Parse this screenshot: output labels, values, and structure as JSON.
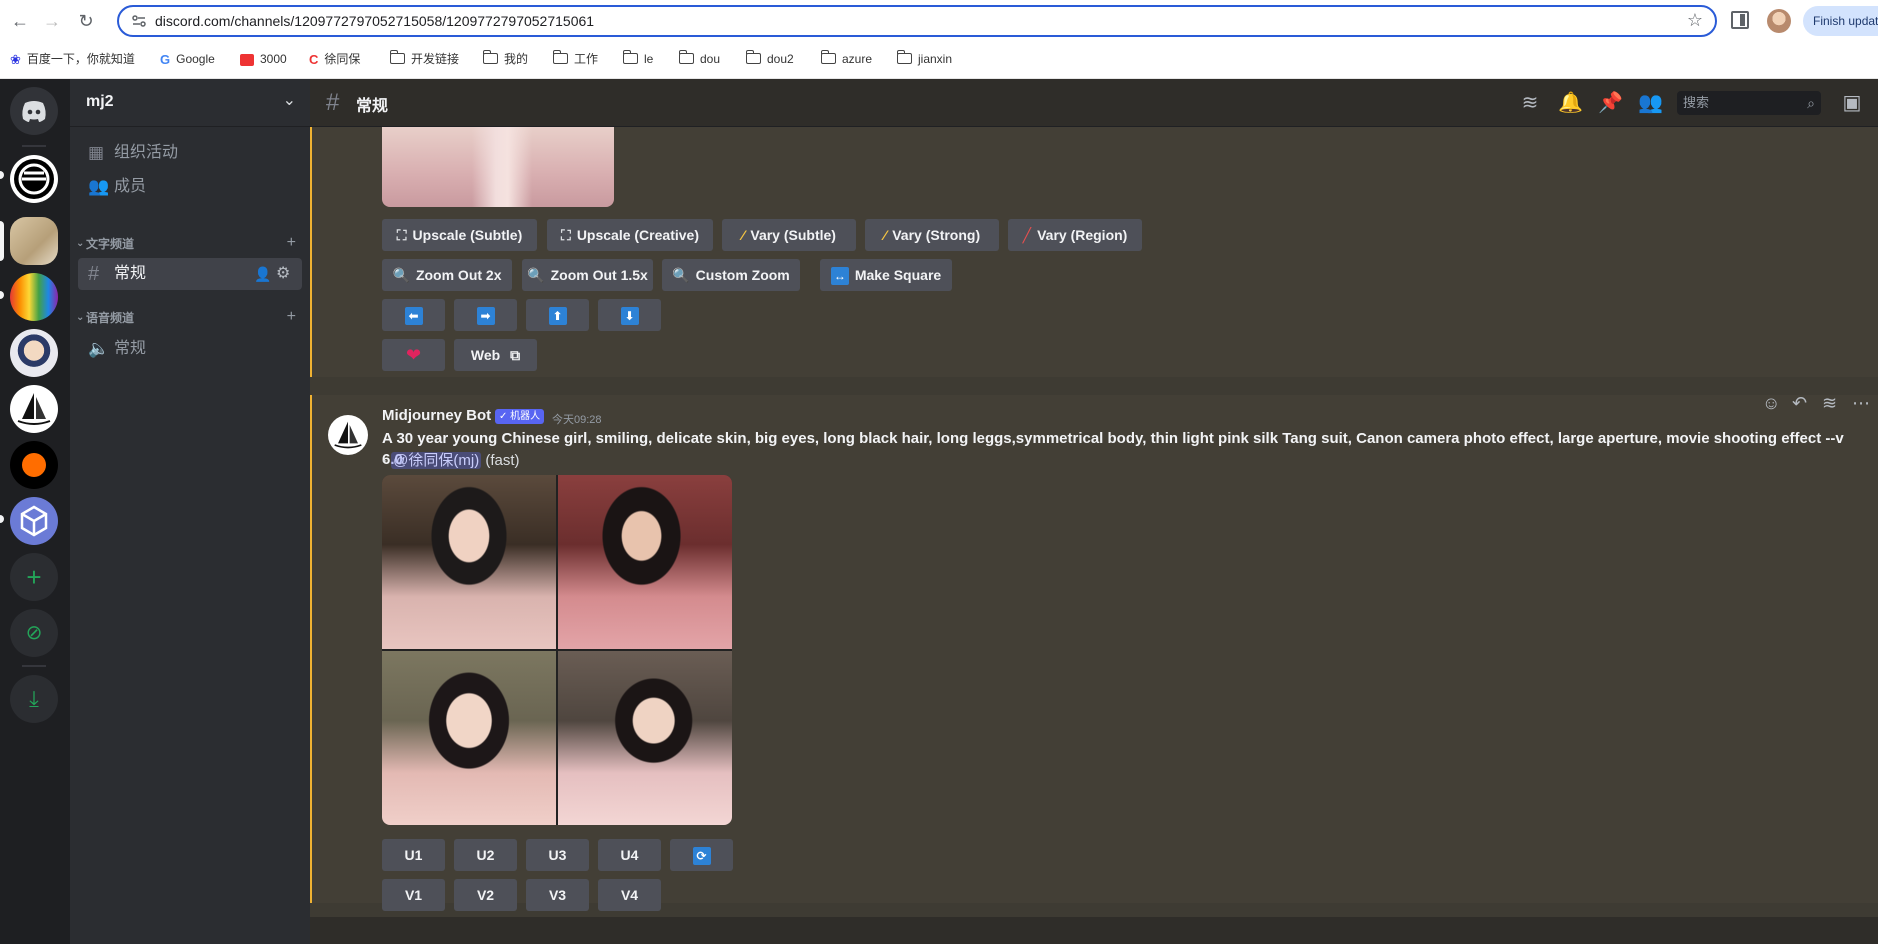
{
  "browser": {
    "url": "discord.com/channels/1209772797052715058/1209772797052715061",
    "finish_update": "Finish update",
    "bookmarks": [
      "百度一下，你就知道",
      "Google",
      "3000",
      "徐同保",
      "开发链接",
      "我的",
      "工作",
      "le",
      "dou",
      "dou2",
      "azure",
      "jianxin"
    ]
  },
  "guild": {
    "name": "mj2",
    "events": "组织活动",
    "members": "成员",
    "text_category": "文字频道",
    "text_channel": "常规",
    "voice_category": "语音频道",
    "voice_channel": "常规"
  },
  "header": {
    "channel": "常规",
    "search_placeholder": "搜索"
  },
  "prev_message": {
    "buttons_row1": [
      "Upscale (Subtle)",
      "Upscale (Creative)",
      "Vary (Subtle)",
      "Vary (Strong)",
      "Vary (Region)"
    ],
    "buttons_row2": [
      "Zoom Out 2x",
      "Zoom Out 1.5x",
      "Custom Zoom",
      "Make Square"
    ],
    "web": "Web"
  },
  "message": {
    "author": "Midjourney Bot",
    "bot_tag": "✓ 机器人",
    "timestamp": "今天09:28",
    "prompt": "A 30 year young Chinese girl, smiling, delicate skin, big eyes, long black hair, long leggs,symmetrical body, thin light pink silk Tang suit, Canon camera photo effect, large aperture, movie shooting effect --v 6.0",
    "prefix": "- ",
    "mention": "@徐同保(mj)",
    "mode": " (fast)",
    "u_buttons": [
      "U1",
      "U2",
      "U3",
      "U4"
    ],
    "v_buttons": [
      "V1",
      "V2",
      "V3",
      "V4"
    ]
  },
  "colors": {
    "accent_border": "#f0b232",
    "button_bg": "#4e5058",
    "bot_tag": "#5865f2"
  }
}
